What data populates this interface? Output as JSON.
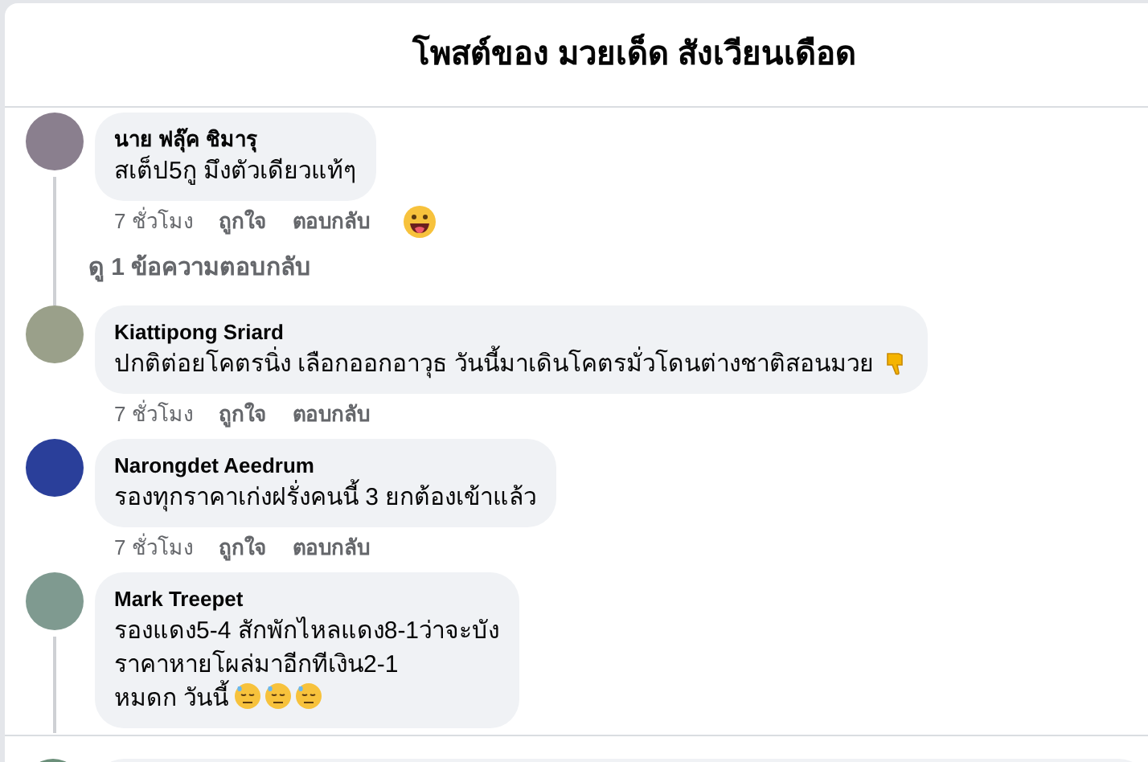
{
  "dialog": {
    "title": "โพสต์ของ มวยเด็ด สังเวียนเดือด"
  },
  "comments": [
    {
      "author": "นาย ฟลุ๊ค ชิมารุ",
      "lines": [
        "สเต็ป5กู มึงตัวเดียวแท้ๆ"
      ],
      "time": "7 ชั่วโมง",
      "like": "ถูกใจ",
      "reply": "ตอบกลับ",
      "reaction": {
        "kind": "grin"
      },
      "view_replies": "ดู 1 ข้อความตอบกลับ"
    },
    {
      "author": "Kiattipong Sriard",
      "lines": [
        "ปกติต่อยโคตรนิ่ง เลือกออกอาวุธ วันนี้มาเดินโคตรมั่วโดนต่างชาติสอนมวย"
      ],
      "emojis": [
        {
          "kind": "thumbs-down"
        }
      ],
      "time": "7 ชั่วโมง",
      "like": "ถูกใจ",
      "reply": "ตอบกลับ"
    },
    {
      "author": "Narongdet Aeedrum",
      "lines": [
        "รองทุกราคาเก่งฝรั่งคนนี้ 3 ยกต้องเข้าแล้ว"
      ],
      "time": "7 ชั่วโมง",
      "like": "ถูกใจ",
      "reply": "ตอบกลับ"
    },
    {
      "author": "Mark Treepet",
      "lines": [
        "รองแดง5-4 สักพักไหลแดง8-1ว่าจะบัง",
        "ราคาหายโผล่มาอีกทีเงิน2-1",
        "หมดก วันนี้"
      ],
      "emojis": [
        {
          "kind": "sweat-face"
        },
        {
          "kind": "sweat-face"
        },
        {
          "kind": "sweat-face"
        }
      ],
      "thread": true
    }
  ]
}
